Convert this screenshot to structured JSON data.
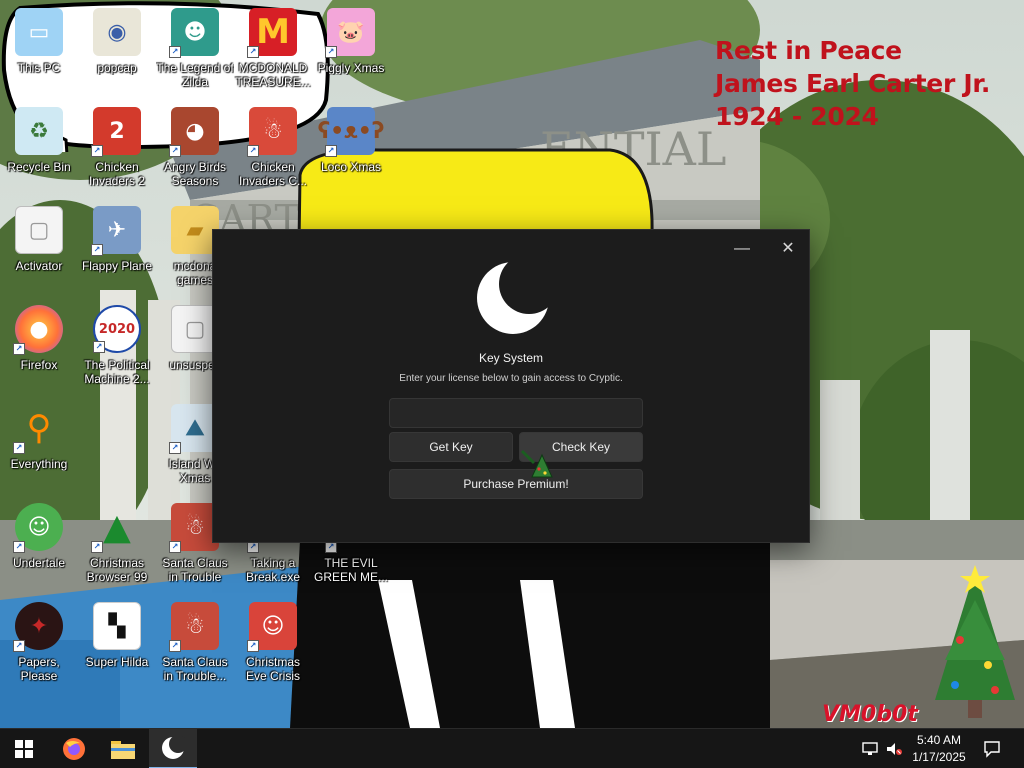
{
  "wallpaper": {
    "memorial_lines": [
      "Rest in Peace",
      "James Earl Carter Jr.",
      "1924 - 2024"
    ],
    "watermark": "VM0b0t",
    "building_sign_lines": [
      "ENTIAL",
      "CART"
    ]
  },
  "desktop_icons": [
    {
      "label": "This PC",
      "icon": "computer-icon",
      "shortcut": false
    },
    {
      "label": "popcap",
      "icon": "folder-icon",
      "shortcut": false
    },
    {
      "label": "The Legend of Zilda",
      "icon": "game-character-icon",
      "shortcut": true
    },
    {
      "label": "MCDONALD TREASURE...",
      "icon": "mcdonalds-icon",
      "shortcut": true
    },
    {
      "label": "Piggly Xmas",
      "icon": "pig-icon",
      "shortcut": true
    },
    {
      "label": "Recycle Bin",
      "icon": "recycle-bin-icon",
      "shortcut": false
    },
    {
      "label": "Chicken Invaders 2",
      "icon": "chicken-icon",
      "shortcut": true
    },
    {
      "label": "Angry Birds Seasons",
      "icon": "angry-birds-icon",
      "shortcut": true
    },
    {
      "label": "Chicken Invaders C...",
      "icon": "snowman-chicken-icon",
      "shortcut": true
    },
    {
      "label": "Loco Xmas",
      "icon": "bear-icon",
      "shortcut": true
    },
    {
      "label": "Activator",
      "icon": "blank-file-icon",
      "shortcut": false
    },
    {
      "label": "Flappy Plane",
      "icon": "plane-icon",
      "shortcut": true
    },
    {
      "label": "mcdona games",
      "icon": "folder-icon",
      "shortcut": false
    },
    {
      "label": "Firefox",
      "icon": "firefox-icon",
      "shortcut": true
    },
    {
      "label": "The Political Machine 2...",
      "icon": "political-machine-icon",
      "shortcut": true
    },
    {
      "label": "unsuspec",
      "icon": "blank-file-icon",
      "shortcut": false
    },
    {
      "label": "Everything",
      "icon": "magnifier-icon",
      "shortcut": true
    },
    {
      "label": "Island Wa Xmas",
      "icon": "island-icon",
      "shortcut": true
    },
    {
      "label": "Undertale",
      "icon": "undertale-icon",
      "shortcut": true
    },
    {
      "label": "Christmas Browser 99",
      "icon": "christmas-tree-icon",
      "shortcut": true
    },
    {
      "label": "Santa Claus in Trouble",
      "icon": "santa-icon",
      "shortcut": true
    },
    {
      "label": "Taking a Break.exe",
      "icon": "blank-exe-icon",
      "shortcut": true
    },
    {
      "label": "THE EVIL GREEN ME...",
      "icon": "evil-green-icon",
      "shortcut": true
    },
    {
      "label": "Papers, Please",
      "icon": "papers-please-icon",
      "shortcut": true
    },
    {
      "label": "Super Hilda",
      "icon": "pixel-dog-icon",
      "shortcut": false
    },
    {
      "label": "Santa Claus in Trouble... A...",
      "icon": "santa-icon",
      "shortcut": true
    },
    {
      "label": "Christmas Eve Crisis",
      "icon": "santa-face-icon",
      "shortcut": true
    }
  ],
  "key_window": {
    "title": "Key System",
    "subtitle": "Enter your license below to gain access to Cryptic.",
    "input_value": "",
    "input_placeholder": "",
    "get_key_label": "Get Key",
    "check_key_label": "Check Key",
    "premium_label": "Purchase Premium!",
    "minimize_symbol": "—",
    "close_symbol": "✕"
  },
  "taskbar": {
    "items": [
      "start-icon",
      "firefox-icon",
      "file-explorer-icon",
      "cryptic-moon-icon"
    ],
    "active_item": "cryptic-moon-icon",
    "time": "5:40 AM",
    "date": "1/17/2025"
  }
}
